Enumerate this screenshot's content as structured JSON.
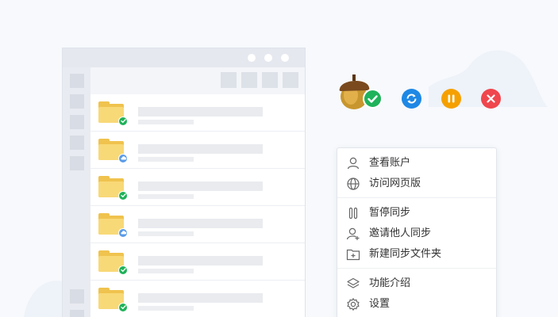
{
  "colors": {
    "page_bg": "#f7f9fc",
    "folder_yellow": "#f0c34e",
    "ok_green": "#1fb25a",
    "sync_blue": "#1e88e5",
    "pause_orange": "#f5a000",
    "close_red": "#f0464d"
  },
  "file_window": {
    "rows": [
      {
        "icon": "folder-icon",
        "status": "synced-check-icon"
      },
      {
        "icon": "folder-icon",
        "status": "cloud-icon"
      },
      {
        "icon": "folder-icon",
        "status": "synced-check-icon"
      },
      {
        "icon": "folder-icon",
        "status": "cloud-icon"
      },
      {
        "icon": "folder-icon",
        "status": "synced-check-icon"
      },
      {
        "icon": "folder-icon",
        "status": "synced-check-icon"
      }
    ]
  },
  "status_icons": [
    "acorn-app-icon",
    "sync-icon",
    "pause-icon",
    "close-icon"
  ],
  "context_menu": {
    "items": [
      {
        "icon": "user-icon",
        "label": "查看账户"
      },
      {
        "icon": "globe-icon",
        "label": "访问网页版"
      },
      {
        "icon": "pause-icon",
        "label": "暂停同步"
      },
      {
        "icon": "add-user-icon",
        "label": "邀请他人同步"
      },
      {
        "icon": "new-folder-icon",
        "label": "新建同步文件夹"
      },
      {
        "icon": "layers-icon",
        "label": "功能介绍"
      },
      {
        "icon": "gear-icon",
        "label": "设置"
      }
    ]
  }
}
